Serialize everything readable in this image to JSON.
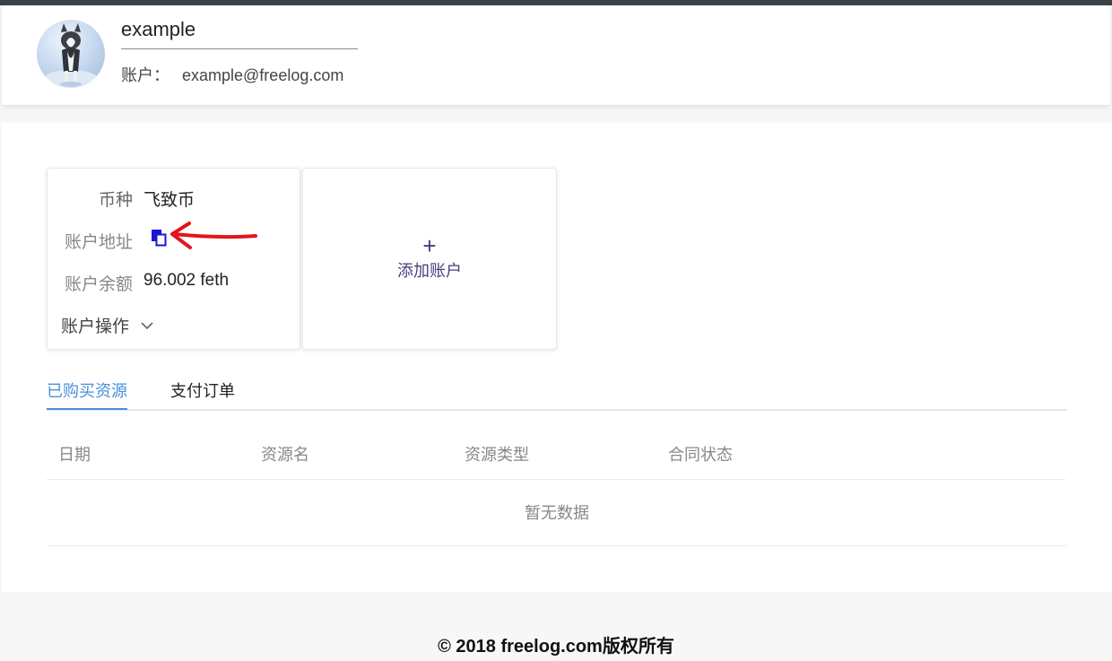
{
  "profile": {
    "username": "example",
    "account_label": "账户：",
    "account_email": "example@freelog.com"
  },
  "wallet": {
    "currency_label": "币种",
    "currency_value": "飞致币",
    "address_label": "账户地址",
    "balance_label": "账户余额",
    "balance_value": "96.002 feth",
    "actions_label": "账户操作"
  },
  "add_account": {
    "plus": "+",
    "label": "添加账户"
  },
  "tabs": [
    {
      "label": "已购买资源",
      "active": true
    },
    {
      "label": "支付订单",
      "active": false
    }
  ],
  "table": {
    "columns": [
      "日期",
      "资源名",
      "资源类型",
      "合同状态"
    ],
    "empty_text": "暂无数据"
  },
  "footer": {
    "text": "© 2018 freelog.com版权所有"
  },
  "colors": {
    "accent": "#4a90d9",
    "add_text": "#4b3c7a",
    "copy_icon": "#1a14d6",
    "annotation_arrow": "#e3141c",
    "topbar": "#3a4446"
  },
  "icons": {
    "copy": "copy-icon",
    "chevron": "chevron-down-icon",
    "plus": "plus-icon",
    "annotation": "red-arrow-annotation"
  }
}
